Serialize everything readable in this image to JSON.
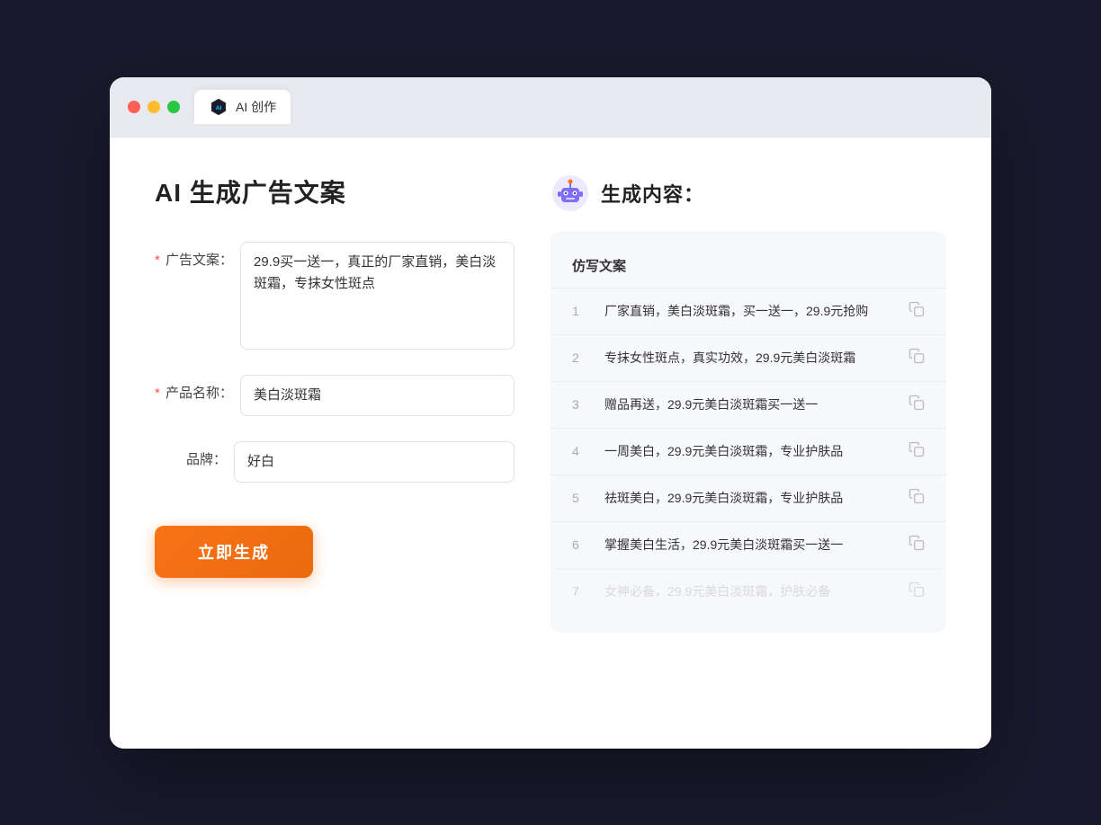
{
  "tab": {
    "label": "AI 创作"
  },
  "page": {
    "title": "AI 生成广告文案"
  },
  "form": {
    "ad_copy_label": "广告文案：",
    "ad_copy_required": true,
    "ad_copy_value": "29.9买一送一，真正的厂家直销，美白淡斑霜，专抹女性斑点",
    "product_name_label": "产品名称：",
    "product_name_required": true,
    "product_name_value": "美白淡斑霜",
    "brand_label": "品牌：",
    "brand_required": false,
    "brand_value": "好白",
    "generate_button": "立即生成"
  },
  "result": {
    "header": "生成内容：",
    "table_header": "仿写文案",
    "rows": [
      {
        "num": "1",
        "text": "厂家直销，美白淡斑霜，买一送一，29.9元抢购"
      },
      {
        "num": "2",
        "text": "专抹女性斑点，真实功效，29.9元美白淡斑霜"
      },
      {
        "num": "3",
        "text": "赠品再送，29.9元美白淡斑霜买一送一"
      },
      {
        "num": "4",
        "text": "一周美白，29.9元美白淡斑霜，专业护肤品"
      },
      {
        "num": "5",
        "text": "祛斑美白，29.9元美白淡斑霜，专业护肤品"
      },
      {
        "num": "6",
        "text": "掌握美白生活，29.9元美白淡斑霜买一送一"
      },
      {
        "num": "7",
        "text": "女神必备，29.9元美白淡斑霜，护肤必备",
        "faded": true
      }
    ]
  }
}
